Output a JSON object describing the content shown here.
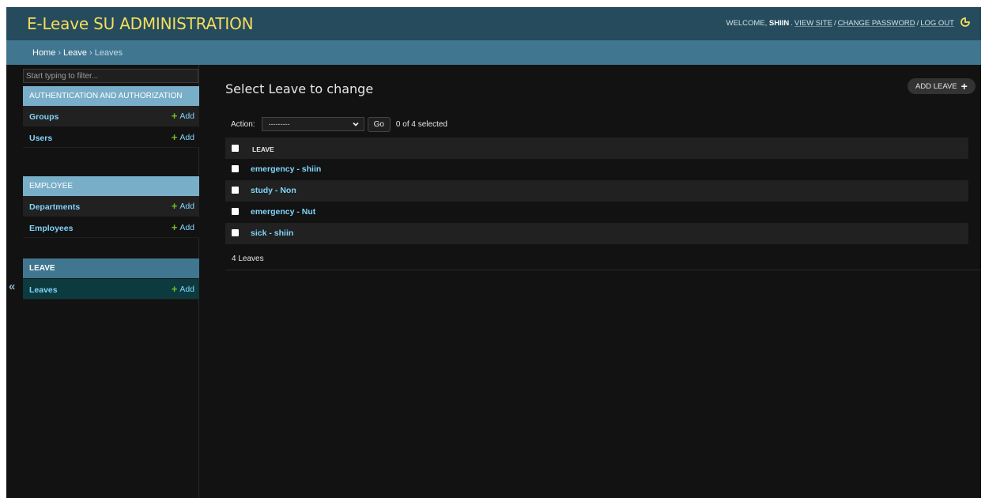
{
  "header": {
    "site_title": "E-Leave SU ADMINISTRATION",
    "welcome_prefix": "WELCOME,",
    "username": "SHIIN",
    "view_site": "VIEW SITE",
    "change_password": "CHANGE PASSWORD",
    "log_out": "LOG OUT",
    "separator": "/",
    "theme_icon": "half-moon-icon"
  },
  "breadcrumbs": {
    "items": [
      "Home",
      "Leave",
      "Leaves"
    ],
    "separator": "›"
  },
  "sidebar": {
    "filter_placeholder": "Start typing to filter...",
    "collapse_glyph": "«",
    "add_label": "Add",
    "add_glyph": "+",
    "modules": [
      {
        "caption": "AUTHENTICATION AND AUTHORIZATION",
        "models": [
          "Groups",
          "Users"
        ]
      },
      {
        "caption": "EMPLOYEE",
        "models": [
          "Departments",
          "Employees"
        ]
      },
      {
        "caption": "LEAVE",
        "models": [
          "Leaves"
        ],
        "current": true
      }
    ]
  },
  "content": {
    "title": "Select Leave to change",
    "add_button": "ADD LEAVE",
    "add_glyph": "+",
    "actions": {
      "label": "Action:",
      "selected": "---------",
      "go": "Go",
      "counter": "0 of 4 selected"
    },
    "table": {
      "column": "LEAVE",
      "rows": [
        "emergency - shiin",
        "study - Non",
        "emergency - Nut",
        "sick - shiin"
      ]
    },
    "paginator": "4 Leaves"
  },
  "colors": {
    "header_bg": "#264b5d",
    "breadcrumb_bg": "#417690",
    "module_caption_bg": "#79aec8",
    "site_title": "#f5dd5d",
    "link": "#81d4fa",
    "add_plus": "#70bf2b",
    "page_bg": "#121212"
  }
}
